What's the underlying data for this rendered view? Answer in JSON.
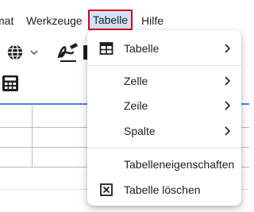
{
  "menubar": {
    "items": [
      {
        "label": "mat"
      },
      {
        "label": "Werkzeuge"
      },
      {
        "label": "Tabelle"
      },
      {
        "label": "Hilfe"
      }
    ]
  },
  "toolbar": {
    "icons": [
      "globe-icon",
      "chevron-down-icon",
      "signature-icon",
      "calculator-icon"
    ]
  },
  "dropdown": {
    "items": [
      {
        "label": "Tabelle",
        "icon": "table-icon",
        "submenu": true
      },
      {
        "label": "Zelle",
        "submenu": true
      },
      {
        "label": "Zeile",
        "submenu": true
      },
      {
        "label": "Spalte",
        "submenu": true
      },
      {
        "label": "Tabelleneigenschaften",
        "submenu": false
      },
      {
        "label": "Tabelle löschen",
        "icon": "delete-table-icon",
        "submenu": false
      }
    ]
  },
  "colors": {
    "active_menu_bg": "#d2e3fc",
    "highlight_border": "#d6001c",
    "accent_line": "#4a86e8"
  }
}
